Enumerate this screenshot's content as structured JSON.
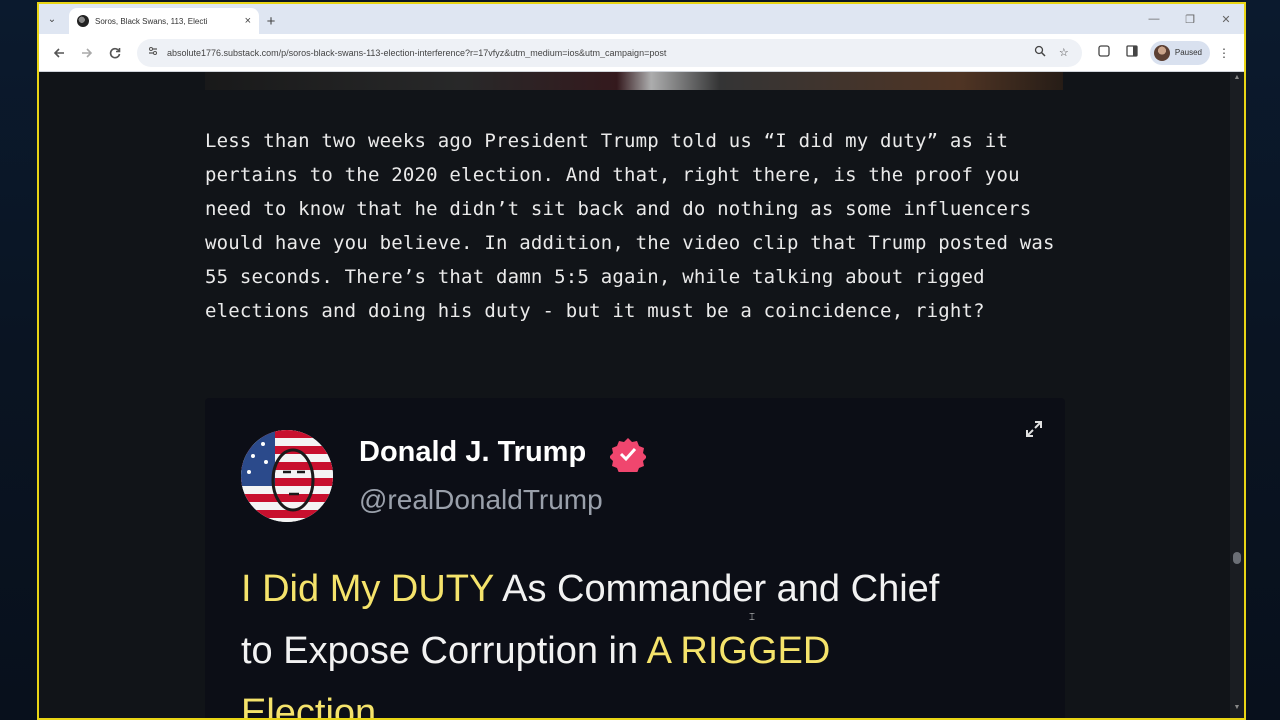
{
  "browser": {
    "tab_title": "Soros, Black Swans, 113, Electi",
    "tab_close": "×",
    "new_tab": "+",
    "url": "absolute1776.substack.com/p/soros-black-swans-113-election-interference?r=17vfyz&utm_medium=ios&utm_campaign=post",
    "profile_status": "Paused",
    "controls": {
      "minimize": "—",
      "restore": "❐",
      "close": "✕"
    }
  },
  "article": {
    "paragraph": "Less than two weeks ago President Trump told us “I did my duty” as it pertains to the 2020 election. And that, right there, is the proof you need to know that he didn’t sit back and do nothing as some influencers would have you believe. In addition, the video clip that Trump posted was 55 seconds. There’s that damn 5:5 again, while talking about rigged elections and doing his duty - but it must be a coincidence, right?"
  },
  "tweet": {
    "name": "Donald J. Trump",
    "handle": "@realDonaldTrump",
    "body_hl1": "I Did My DUTY",
    "body_mid1": " As Commander and Chief",
    "body_mid2": "to Expose Corruption in ",
    "body_hl2": "A RIGGED",
    "body_tail": "Election..."
  },
  "colors": {
    "accent_yellow": "#f5e36b",
    "verified_pink": "#f0466e",
    "window_border": "#e9d515"
  },
  "icons": {
    "back": "back-icon",
    "forward": "forward-icon",
    "reload": "reload-icon",
    "expand": "expand-icon",
    "verified": "verified-badge-icon"
  }
}
